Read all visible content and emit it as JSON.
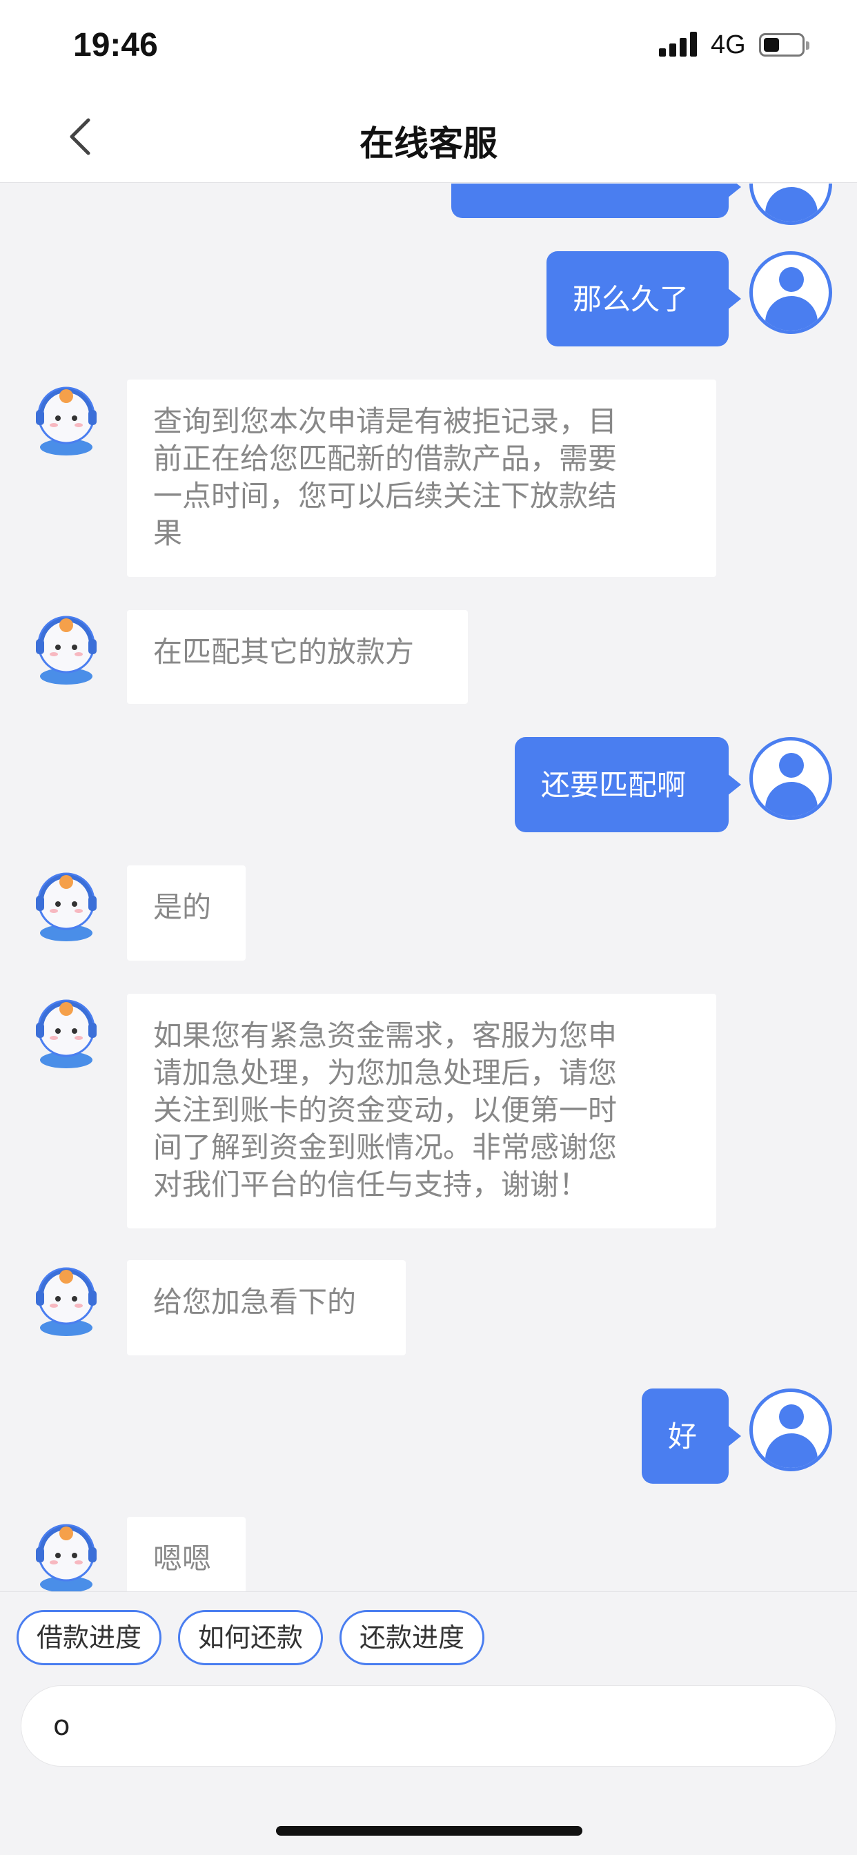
{
  "status_bar": {
    "time": "19:46",
    "network": "4G"
  },
  "header": {
    "title": "在线客服"
  },
  "messages": [
    {
      "role": "user",
      "text": ""
    },
    {
      "role": "user",
      "text": "那么久了"
    },
    {
      "role": "bot",
      "lines": [
        "查询到您本次申请是有被拒记录，目",
        "前正在给您匹配新的借款产品，需要",
        "一点时间，您可以后续关注下放款结",
        "果"
      ]
    },
    {
      "role": "bot",
      "lines": [
        "在匹配其它的放款方"
      ]
    },
    {
      "role": "user",
      "text": "还要匹配啊"
    },
    {
      "role": "bot",
      "lines": [
        "是的"
      ]
    },
    {
      "role": "bot",
      "lines": [
        "如果您有紧急资金需求，客服为您申",
        "请加急处理，为您加急处理后，请您",
        "关注到账卡的资金变动，以便第一时",
        "间了解到资金到账情况。非常感谢您",
        "对我们平台的信任与支持，谢谢！"
      ]
    },
    {
      "role": "bot",
      "lines": [
        "给您加急看下的"
      ]
    },
    {
      "role": "user",
      "text": "好"
    },
    {
      "role": "bot",
      "lines": [
        "嗯嗯"
      ]
    }
  ],
  "quick_replies": [
    "借款进度",
    "如何还款",
    "还款进度"
  ],
  "input": {
    "value": "o"
  },
  "colors": {
    "accent": "#4a7ef0",
    "background": "#f3f3f5",
    "bot_text": "#888888"
  },
  "icons": {
    "back": "chevron-left-icon",
    "user_avatar": "user-avatar-icon",
    "bot_avatar": "support-agent-avatar-icon"
  }
}
